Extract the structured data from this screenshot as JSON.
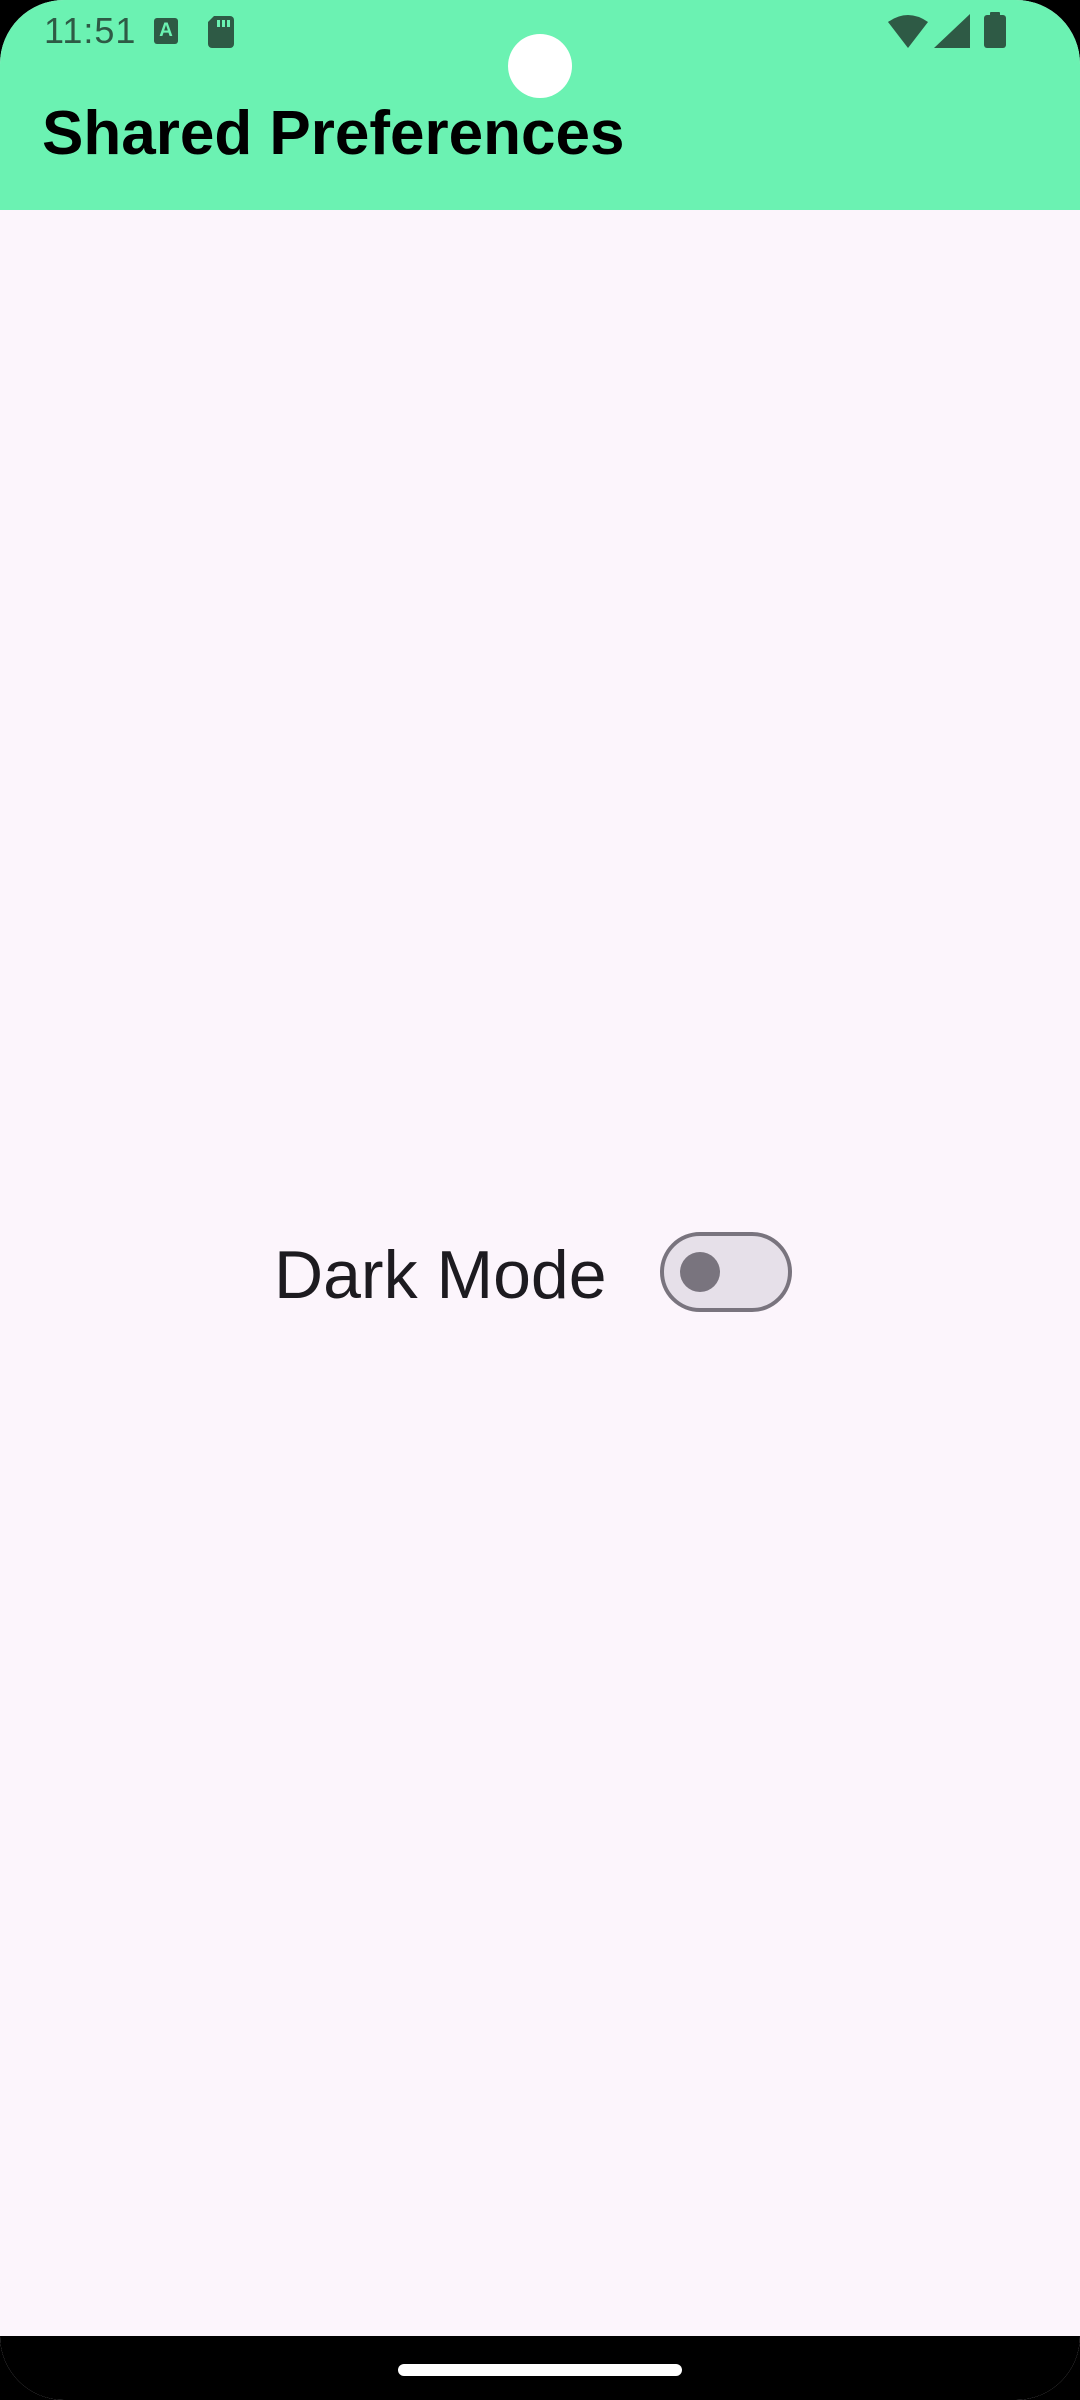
{
  "status_bar": {
    "time": "11:51",
    "notification_letter": "A",
    "icons": [
      "a-notification-icon",
      "sd-card-icon",
      "wifi-icon",
      "signal-icon",
      "battery-icon"
    ]
  },
  "app_bar": {
    "title": "Shared Preferences",
    "color": "#6BF2B2"
  },
  "settings": {
    "dark_mode": {
      "label": "Dark Mode",
      "enabled": false
    }
  },
  "colors": {
    "background": "#FCF5FC",
    "switch_outline": "#79747E",
    "switch_track": "#E6E0E9"
  }
}
